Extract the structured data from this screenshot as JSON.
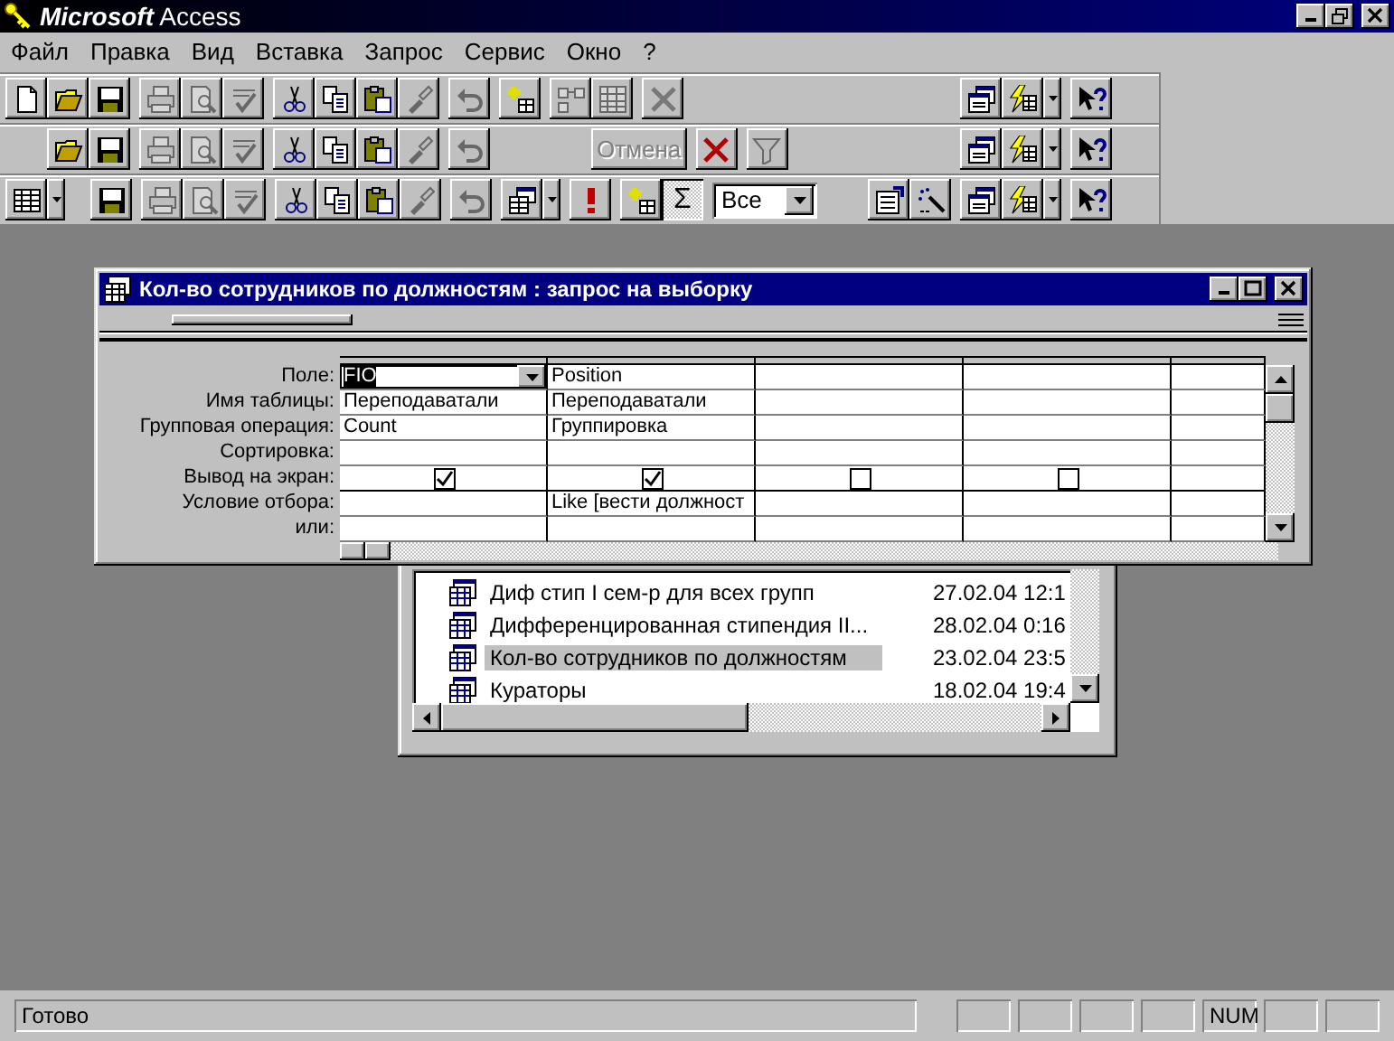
{
  "window": {
    "title": "**Microsoft** Access"
  },
  "menu": [
    {
      "label": "Файл"
    },
    {
      "label": "Правка"
    },
    {
      "label": "Вид"
    },
    {
      "label": "Вставка"
    },
    {
      "label": "Запрос"
    },
    {
      "label": "Сервис"
    },
    {
      "label": "Окно"
    },
    {
      "label": "?"
    }
  ],
  "toolbars": [
    {
      "items": [
        {
          "kind": "icon",
          "disabled": false
        },
        {
          "kind": "icon",
          "disabled": false
        },
        {
          "kind": "icon",
          "disabled": false
        },
        {
          "kind": "icon",
          "disabled": true
        },
        {
          "kind": "icon",
          "disabled": true
        },
        {
          "kind": "icon",
          "disabled": true
        },
        {
          "kind": "icon",
          "disabled": false
        },
        {
          "kind": "icon",
          "disabled": false
        },
        {
          "kind": "icon",
          "disabled": false
        },
        {
          "kind": "icon",
          "disabled": true
        },
        {
          "kind": "icon",
          "disabled": true
        },
        {
          "kind": "icon",
          "disabled": false
        },
        {
          "kind": "icon",
          "disabled": true
        },
        {
          "kind": "icon",
          "disabled": true
        },
        {
          "kind": "icon",
          "disabled": true
        },
        {
          "kind": "icon",
          "disabled": false
        },
        {
          "kind": "icon",
          "disabled": false
        },
        {
          "kind": "icon",
          "disabled": false
        }
      ]
    },
    {
      "items": [
        {
          "kind": "icon",
          "disabled": false
        },
        {
          "kind": "icon",
          "disabled": false
        },
        {
          "kind": "icon",
          "disabled": true
        },
        {
          "kind": "icon",
          "disabled": true
        },
        {
          "kind": "icon",
          "disabled": true
        },
        {
          "kind": "icon",
          "disabled": false
        },
        {
          "kind": "icon",
          "disabled": false
        },
        {
          "kind": "icon",
          "disabled": false
        },
        {
          "kind": "icon",
          "disabled": true
        },
        {
          "kind": "icon",
          "disabled": true
        },
        {
          "kind": "text",
          "label": "Отмена",
          "disabled": true
        },
        {
          "kind": "icon",
          "disabled": false
        },
        {
          "kind": "icon",
          "disabled": true
        },
        {
          "kind": "icon",
          "disabled": false
        },
        {
          "kind": "icon",
          "disabled": false
        },
        {
          "kind": "icon",
          "disabled": false
        }
      ]
    },
    {
      "items": [
        {
          "kind": "icon",
          "disabled": false
        },
        {
          "kind": "icon",
          "disabled": false
        },
        {
          "kind": "icon",
          "disabled": true
        },
        {
          "kind": "icon",
          "disabled": true
        },
        {
          "kind": "icon",
          "disabled": true
        },
        {
          "kind": "icon",
          "disabled": false
        },
        {
          "kind": "icon",
          "disabled": false
        },
        {
          "kind": "icon",
          "disabled": false
        },
        {
          "kind": "icon",
          "disabled": true
        },
        {
          "kind": "icon",
          "disabled": true
        },
        {
          "kind": "icon",
          "disabled": false
        },
        {
          "kind": "icon",
          "disabled": false
        },
        {
          "kind": "icon",
          "disabled": false
        },
        {
          "kind": "text",
          "label": "Σ",
          "disabled": false,
          "pressed": true
        },
        {
          "kind": "combo",
          "value": "Все"
        },
        {
          "kind": "icon",
          "disabled": false
        },
        {
          "kind": "icon",
          "disabled": false
        },
        {
          "kind": "icon",
          "disabled": false
        },
        {
          "kind": "icon",
          "disabled": false
        },
        {
          "kind": "icon",
          "disabled": false
        }
      ]
    }
  ],
  "query_window": {
    "title": "Кол-во сотрудников по должностям : запрос на выборку",
    "row_labels": [
      "Поле:",
      "Имя таблицы:",
      "Групповая операция:",
      "Сортировка:",
      "Вывод на экран:",
      "Условие отбора:",
      "или:"
    ],
    "columns": [
      {
        "field": "FIO",
        "table": "Переподаватали",
        "total": "Count",
        "show": true,
        "selected": true
      },
      {
        "field": "Position",
        "table": "Переподаватали",
        "total": "Группировка",
        "show": true,
        "criteria": "Like [вести должност",
        "selected": false
      },
      {
        "show": false,
        "selected": false
      },
      {
        "show": false,
        "selected": false
      }
    ]
  },
  "database_window": {
    "items": [
      {
        "name": "Диф стип I сем-р для всех групп",
        "date": "27.02.04 12:1",
        "selected": false
      },
      {
        "name": "Дифференцированная стипендия II...",
        "date": "28.02.04 0:16",
        "selected": false
      },
      {
        "name": "Кол-во сотрудников по должностям",
        "date": "23.02.04 23:5",
        "selected": true
      },
      {
        "name": "Кураторы",
        "date": "18.02.04 19:4",
        "selected": false
      }
    ]
  },
  "status_bar": {
    "text": "Готово",
    "indicators": [
      {
        "label": "NUM"
      }
    ]
  }
}
